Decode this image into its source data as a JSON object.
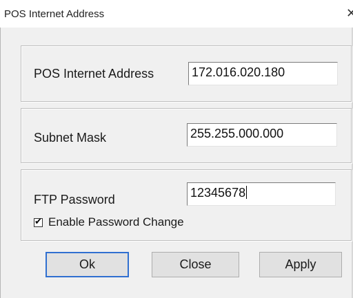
{
  "window": {
    "title": "POS Internet Address",
    "close_glyph": "✕",
    "close_icon": "close-icon"
  },
  "groups": {
    "address": {
      "label": "POS Internet Address",
      "value": "172.016.020.180"
    },
    "subnet": {
      "label": "Subnet Mask",
      "value": "255.255.000.000"
    },
    "ftp": {
      "label": "FTP Password",
      "value": "12345678",
      "enable_change": {
        "label": "Enable Password Change",
        "checked": true,
        "check_glyph": "✔"
      }
    }
  },
  "buttons": {
    "ok": "Ok",
    "close": "Close",
    "apply": "Apply"
  },
  "colors": {
    "dialog_background": "#f0f0f0",
    "focus_border": "#2f6fd0"
  }
}
